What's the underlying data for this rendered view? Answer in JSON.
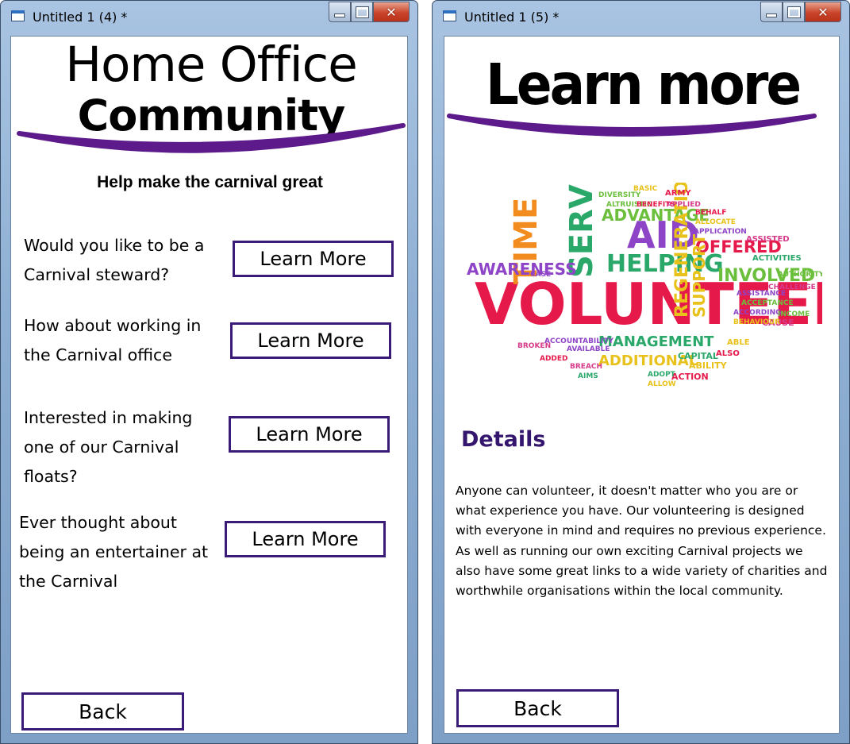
{
  "windows": [
    {
      "title": "Untitled 1 (4) *",
      "logo": {
        "line1": "Home Office",
        "line2": "Community"
      },
      "subtitle": "Help make the carnival great",
      "questions": [
        {
          "text": "Would you like to be a Carnival steward?",
          "button": "Learn More"
        },
        {
          "text": "How about working in the Carnival office",
          "button": "Learn More"
        },
        {
          "text": "Interested in making one of our Carnival floats?",
          "button": "Learn More"
        },
        {
          "text": "Ever thought about being an entertainer at the Carnival",
          "button": "Learn More"
        }
      ],
      "back_label": "Back"
    },
    {
      "title": "Untitled 1 (5) *",
      "heading": "Learn more",
      "word_cloud": [
        "VOLUNTEER",
        "TIME",
        "SERVICES",
        "AID",
        "HELPING",
        "ADVANTAGE",
        "OFFERED",
        "REGENERATION",
        "SUPPORT",
        "INVOLVED",
        "MANAGEMENT",
        "ADDITIONAL",
        "AWARENESS",
        "DIVERSITY",
        "ALTRUISTIC",
        "BENEFITS",
        "APPLIED",
        "BEHALF",
        "ALLOCATE",
        "APPLICATION",
        "ASSISTED",
        "ACTIVITIES",
        "ACCOUNTABILITY",
        "AVAILABLE",
        "CAPITAL",
        "ABILITY",
        "ACTION",
        "CAUSE",
        "BASIC",
        "ARMY",
        "ALSO",
        "BREACH",
        "BROKEN",
        "CASE",
        "CHALLENGE",
        "AUTHORITY",
        "ASSISTANCE",
        "ACCEPTANCE",
        "ACCORDING",
        "BEHAVIOUR",
        "INCOME",
        "ABLE",
        "AIMS",
        "ADOPT",
        "ALLOW",
        "ADDED"
      ],
      "details_heading": "Details",
      "details_text": "Anyone can volunteer, it doesn't matter who you are or what experience you have. Our volunteering is designed with everyone in mind and requires no previous experience. As well as running our own exciting Carnival projects we also have some great links to a wide variety of charities and worthwhile organisations within the local community.",
      "back_label": "Back"
    }
  ],
  "colors": {
    "button_border": "#3a1b78",
    "swoosh": "#5c1a8a",
    "details_heading": "#34166e",
    "window_frame": "#8fb0d4",
    "close_button": "#c9442a"
  }
}
